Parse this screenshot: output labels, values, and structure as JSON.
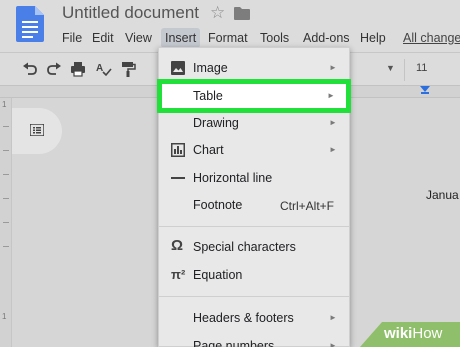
{
  "header": {
    "title": "Untitled document",
    "icons": [
      "docs-logo-icon",
      "star-icon",
      "folder-icon"
    ],
    "star_glyph": "☆"
  },
  "menubar": {
    "items": [
      {
        "label": "File"
      },
      {
        "label": "Edit"
      },
      {
        "label": "View"
      },
      {
        "label": "Insert",
        "active": true
      },
      {
        "label": "Format"
      },
      {
        "label": "Tools"
      },
      {
        "label": "Add-ons"
      },
      {
        "label": "Help"
      },
      {
        "label": "All change"
      }
    ]
  },
  "toolbar": {
    "icons": [
      "undo-icon",
      "redo-icon",
      "print-icon",
      "spellcheck-icon",
      "paint-format-icon"
    ],
    "font_size": "11",
    "dropdown_glyph": "▼"
  },
  "insert_menu": {
    "items": [
      {
        "label": "Image",
        "icon": "image-icon",
        "submenu": true
      },
      {
        "label": "Table",
        "icon": "",
        "submenu": true,
        "highlighted": true
      },
      {
        "label": "Drawing",
        "icon": "",
        "submenu": true
      },
      {
        "label": "Chart",
        "icon": "chart-icon",
        "submenu": true
      },
      {
        "label": "Horizontal line",
        "icon": "horizontal-line-icon",
        "submenu": false
      },
      {
        "label": "Footnote",
        "icon": "",
        "submenu": false,
        "shortcut": "Ctrl+Alt+F"
      },
      {
        "label": "Special characters",
        "icon": "omega-icon",
        "submenu": false
      },
      {
        "label": "Equation",
        "icon": "pi-icon",
        "submenu": false
      },
      {
        "label": "Headers & footers",
        "icon": "",
        "submenu": true
      },
      {
        "label": "Page numbers",
        "icon": "",
        "submenu": true
      }
    ],
    "arrow_glyph": "►",
    "omega_glyph": "Ω",
    "pi_glyph": "π²"
  },
  "document": {
    "visible_text": "Janua"
  },
  "ruler": {
    "v_numbers": [
      "1",
      "1"
    ]
  },
  "watermark": {
    "wiki": "wiki",
    "how": "How"
  },
  "colors": {
    "highlight_border": "#22e03a",
    "docs_blue": "#4a7fe8",
    "ruler_marker": "#2b6fe0"
  }
}
